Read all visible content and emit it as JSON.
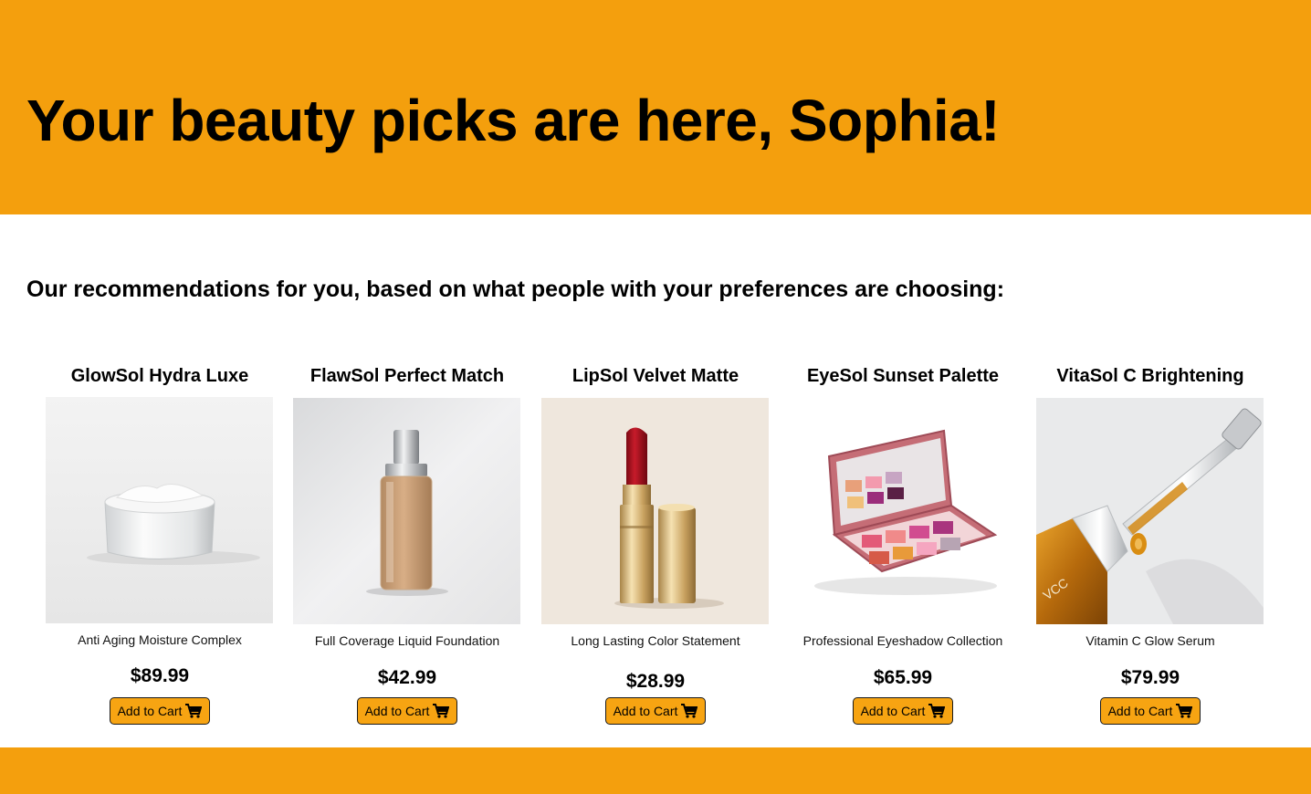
{
  "header": {
    "title": "Your beauty picks are here, Sophia!",
    "background": "#f49f0d"
  },
  "subtitle": "Our recommendations for you, based on what people with your preferences are choosing:",
  "products": [
    {
      "name": "GlowSol Hydra Luxe",
      "description": "Anti Aging Moisture Complex",
      "price": "$89.99",
      "button_label": "Add to Cart",
      "image_icon": "moisturizer-jar"
    },
    {
      "name": "FlawSol Perfect Match",
      "description": "Full Coverage Liquid Foundation",
      "price": "$42.99",
      "button_label": "Add to Cart",
      "image_icon": "foundation-bottle"
    },
    {
      "name": "LipSol Velvet Matte",
      "description": "Long Lasting Color Statement",
      "price": "$28.99",
      "button_label": "Add to Cart",
      "image_icon": "lipstick"
    },
    {
      "name": "EyeSol Sunset Palette",
      "description": "Professional Eyeshadow Collection",
      "price": "$65.99",
      "button_label": "Add to Cart",
      "image_icon": "eyeshadow-palette"
    },
    {
      "name": "VitaSol C Brightening",
      "description": "Vitamin C Glow Serum",
      "price": "$79.99",
      "button_label": "Add to Cart",
      "image_icon": "serum-dropper",
      "bottle_text": "VCC"
    }
  ],
  "colors": {
    "accent": "#f49f0d",
    "button": "#f7a412"
  }
}
